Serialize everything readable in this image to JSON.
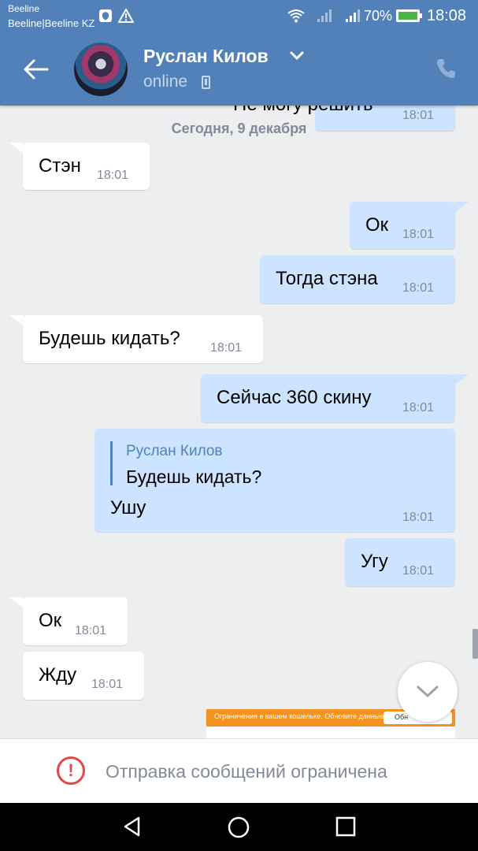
{
  "status_bar": {
    "carrier_line1": "Beeline",
    "carrier_line2": "Beeline|Beeline KZ",
    "battery": "70%",
    "time": "18:08",
    "icons": [
      "shield-icon",
      "warning-icon",
      "wifi-icon",
      "signal-icon",
      "signal-icon",
      "battery-icon"
    ]
  },
  "header": {
    "contact_name": "Руслан Килов",
    "status": "online",
    "icons": [
      "back-arrow-icon",
      "chevron-down-icon",
      "mobile-icon",
      "phone-icon"
    ]
  },
  "messages": {
    "date_separator": "Сегодня, 9 декабря",
    "partial_top_text": "Не могу решить",
    "partial_top_time": "18:01",
    "items": [
      {
        "direction": "in",
        "text": "Стэн",
        "time": "18:01"
      },
      {
        "direction": "out",
        "text": "Ок",
        "time": "18:01"
      },
      {
        "direction": "out",
        "text": "Тогда стэна",
        "time": "18:01"
      },
      {
        "direction": "in",
        "text": "Будешь кидать?",
        "time": "18:01"
      },
      {
        "direction": "out",
        "text": "Сейчас 360 скину",
        "time": "18:01"
      },
      {
        "direction": "out",
        "text": "Ушу",
        "time": "18:01",
        "reply_to": {
          "author": "Руслан Килов",
          "text": "Будешь кидать?"
        }
      },
      {
        "direction": "out",
        "text": "Угу",
        "time": "18:01"
      },
      {
        "direction": "in",
        "text": "Ок",
        "time": "18:01"
      },
      {
        "direction": "in",
        "text": "Жду",
        "time": "18:01"
      }
    ]
  },
  "ad_strip": {
    "text": "Ограничения в вашем кошельке. Обновите данные!",
    "button": "Обн"
  },
  "restriction": {
    "text": "Отправка сообщений ограничена",
    "icon": "alert-circle-icon"
  },
  "colors": {
    "header": "#5181b8",
    "incoming_bubble": "#ffffff",
    "outgoing_bubble": "#cce4ff",
    "background": "#edeef0",
    "warning": "#e64646"
  }
}
